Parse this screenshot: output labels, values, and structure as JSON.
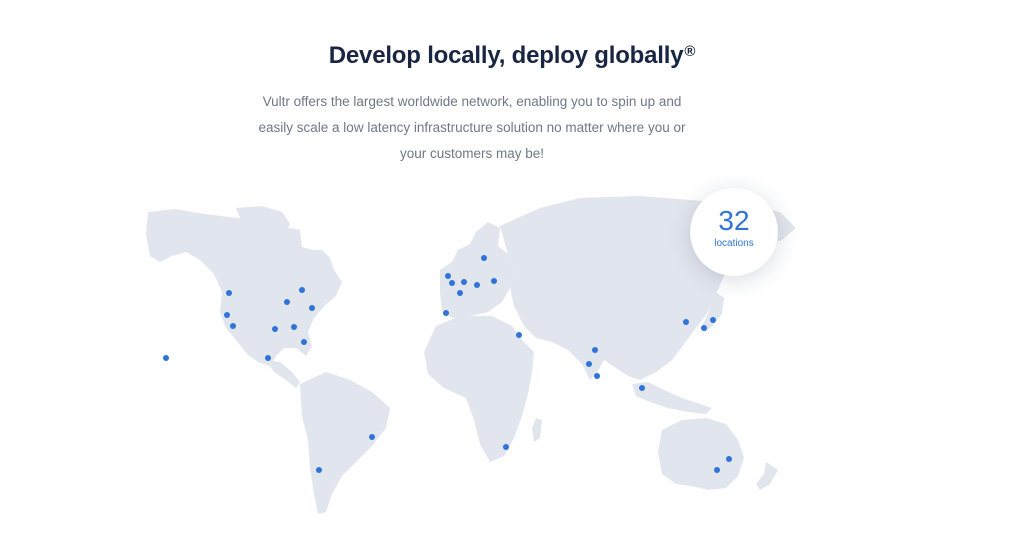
{
  "hero": {
    "title": "Develop locally, deploy globally",
    "title_mark": "®",
    "subtitle_lines": [
      "Vultr offers the largest worldwide network, enabling you to spin up and",
      "easily scale a low latency infrastructure solution no matter where you or",
      "your customers may be!"
    ]
  },
  "locations_badge": {
    "count": "32",
    "label": "locations"
  },
  "colors": {
    "heading": "#1a2543",
    "body_text": "#6f7788",
    "accent": "#2f74d6",
    "land": "#e1e5ed"
  }
}
